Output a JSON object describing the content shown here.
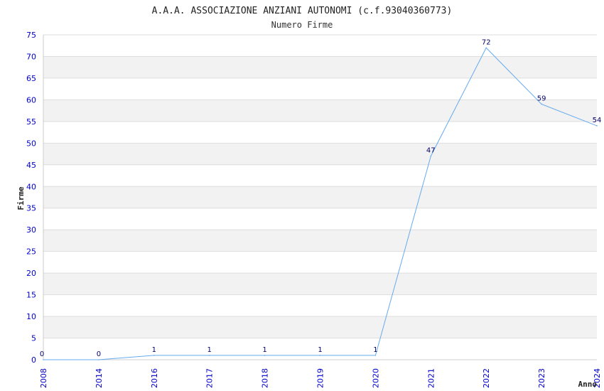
{
  "chart_data": {
    "type": "line",
    "title": "A.A.A. ASSOCIAZIONE ANZIANI AUTONOMI (c.f.93040360773)",
    "subtitle": "Numero Firme",
    "xlabel": "Anno",
    "ylabel": "Firme",
    "x": [
      "2008",
      "2014",
      "2016",
      "2017",
      "2018",
      "2019",
      "2020",
      "2021",
      "2022",
      "2023",
      "2024"
    ],
    "y": [
      0,
      0,
      1,
      1,
      1,
      1,
      1,
      47,
      72,
      59,
      54
    ],
    "ylim": [
      0,
      75
    ],
    "yticks": [
      0,
      5,
      10,
      15,
      20,
      25,
      30,
      35,
      40,
      45,
      50,
      55,
      60,
      65,
      70,
      75
    ],
    "grid": true,
    "colors": {
      "line": "#66aaee",
      "band": "#f2f2f2",
      "grid": "#dddddd",
      "tick": "#0000cc",
      "label": "#000066"
    }
  }
}
